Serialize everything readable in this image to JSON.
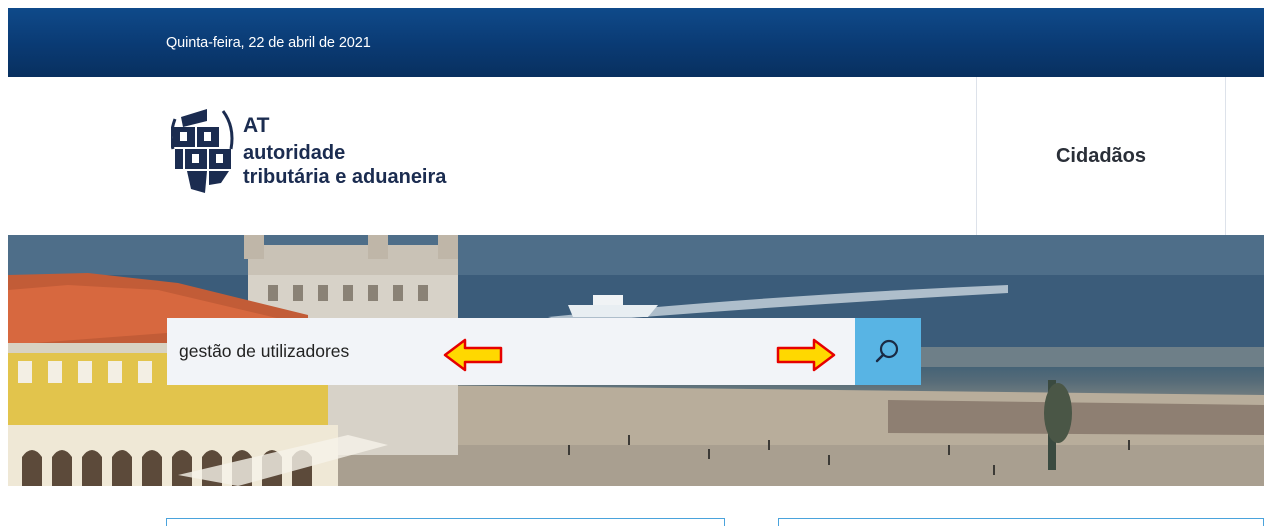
{
  "topbar": {
    "date": "Quinta-feira, 22 de abril de 2021"
  },
  "logo": {
    "abbr": "AT",
    "line1": "autoridade",
    "line2": "tributária e aduaneira"
  },
  "nav": {
    "items": [
      {
        "label": "Cidadãos"
      }
    ]
  },
  "search": {
    "value": "gestão de utilizadores",
    "button_icon": "search-icon"
  },
  "annotations": {
    "arrow_color": "#ffd800",
    "arrow_outline": "#e60000"
  },
  "colors": {
    "topbar": "#0a3a73",
    "search_button": "#58b4e4",
    "brand_text": "#1b2c50",
    "card_border": "#4aa3dc"
  }
}
